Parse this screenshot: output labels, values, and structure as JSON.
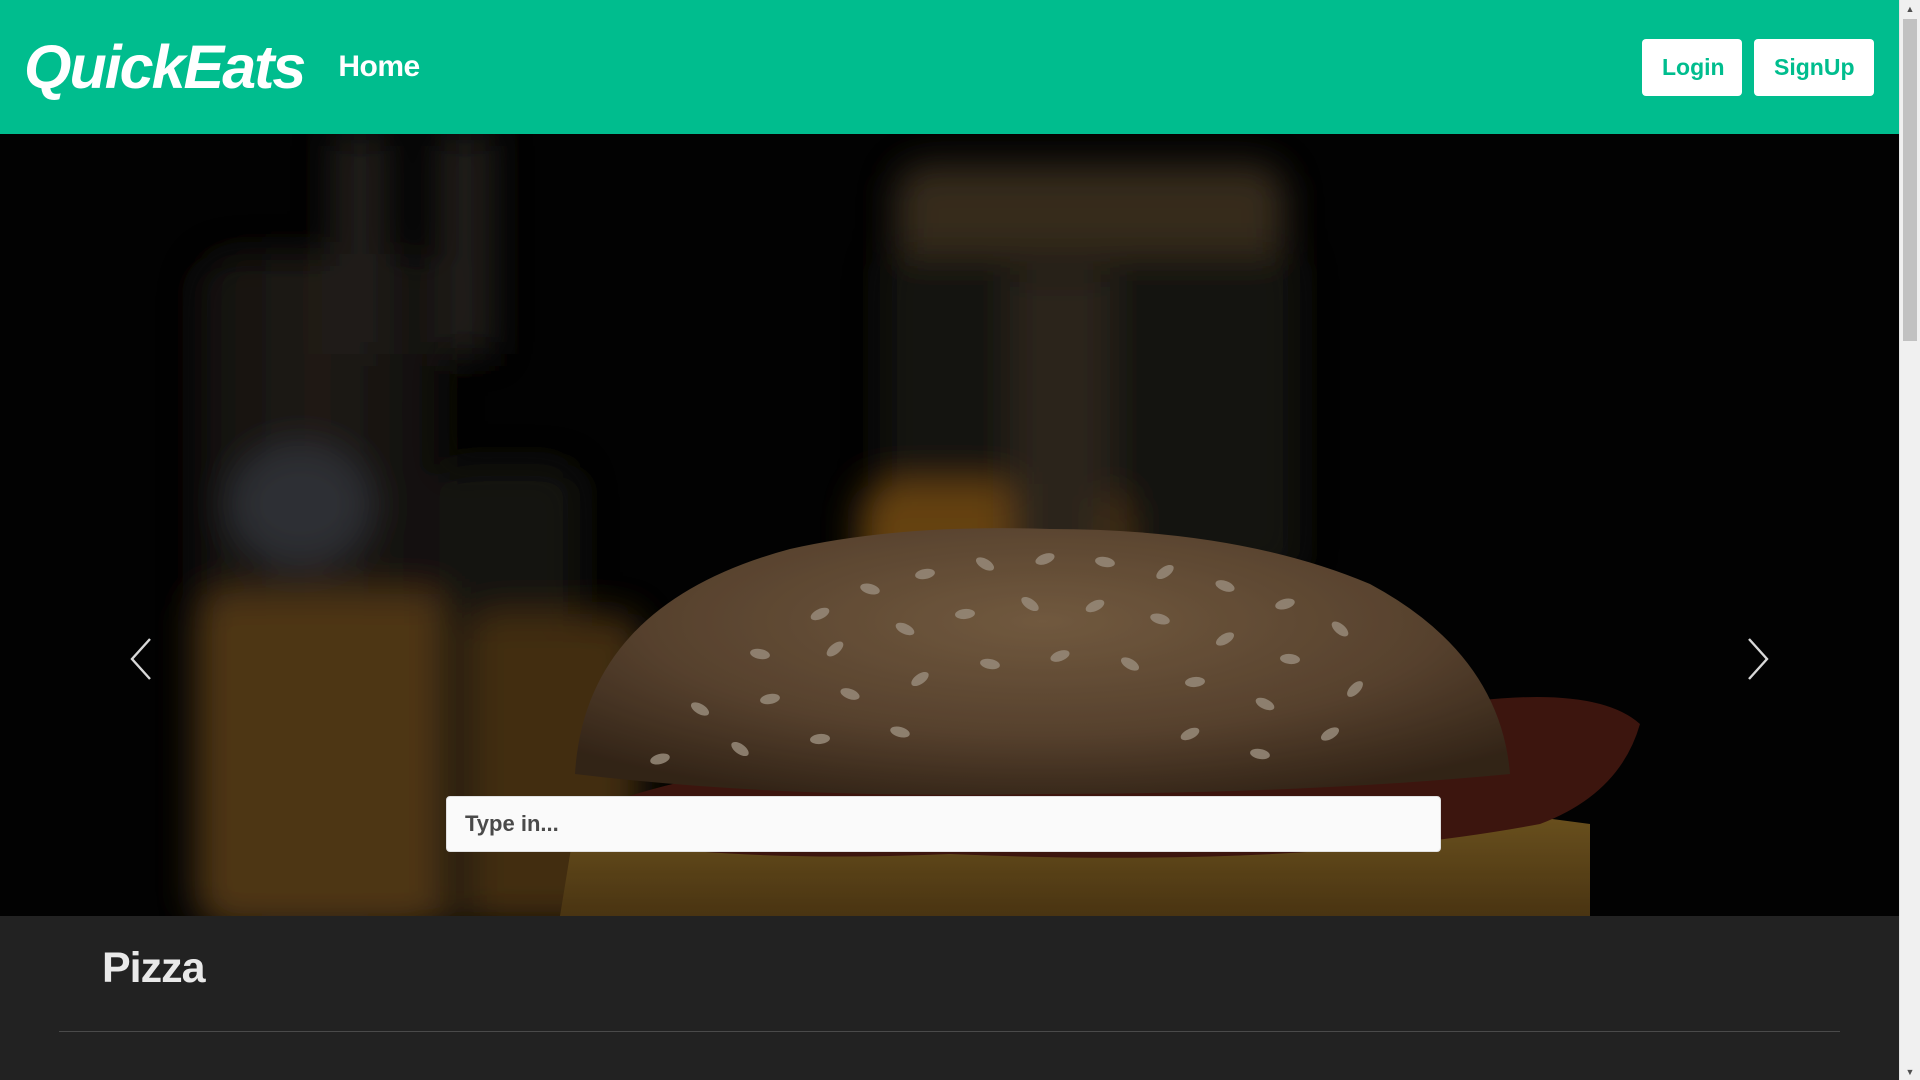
{
  "header": {
    "brand": "QuickEats",
    "nav_home": "Home",
    "login_label": "Login",
    "signup_label": "SignUp"
  },
  "hero": {
    "search_placeholder": "Type in...",
    "prev_icon": "chevron-left-icon",
    "next_icon": "chevron-right-icon",
    "image_subject": "burger"
  },
  "category": {
    "title": "Pizza"
  },
  "colors": {
    "brand": "#00bd8e",
    "header_text": "#ffffff",
    "section_bg": "#222222",
    "hero_bg": "#030303"
  }
}
